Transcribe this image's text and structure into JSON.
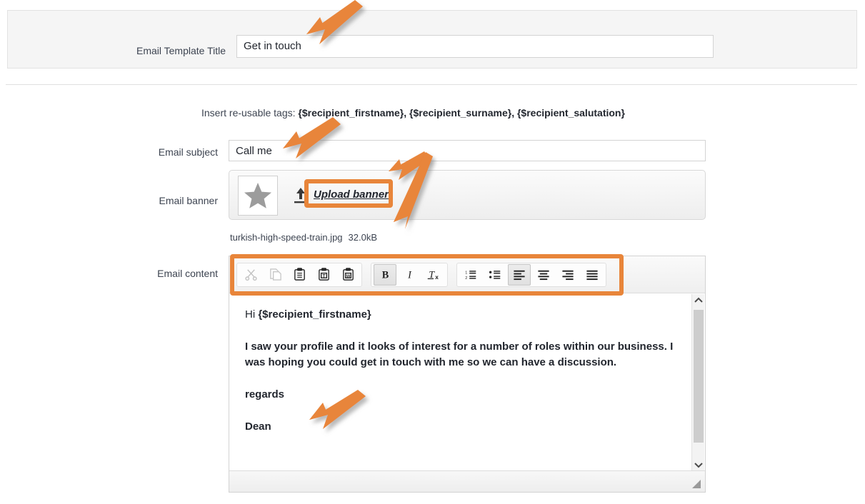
{
  "form": {
    "title_label": "Email Template Title",
    "title_value": "Get in touch",
    "tags_prefix": "Insert re-usable tags: ",
    "tags_list": "{$recipient_firstname}, {$recipient_surname}, {$recipient_salutation}",
    "subject_label": "Email subject",
    "subject_value": "Call me",
    "banner_label": "Email banner",
    "upload_text": "Upload banner",
    "filename": "turkish-high-speed-train.jpg",
    "filesize": "32.0kB",
    "content_label": "Email content"
  },
  "toolbar": {
    "buttons": [
      {
        "name": "cut",
        "label": "Cut",
        "state": "disabled"
      },
      {
        "name": "copy",
        "label": "Copy",
        "state": "disabled"
      },
      {
        "name": "paste",
        "label": "Paste",
        "state": "enabled"
      },
      {
        "name": "paste-text",
        "label": "Paste as plain text",
        "state": "enabled"
      },
      {
        "name": "paste-word",
        "label": "Paste from Word",
        "state": "enabled"
      },
      {
        "name": "bold",
        "label": "Bold",
        "state": "active"
      },
      {
        "name": "italic",
        "label": "Italic",
        "state": "enabled"
      },
      {
        "name": "remove-format",
        "label": "Remove Format",
        "state": "enabled"
      },
      {
        "name": "numbered-list",
        "label": "Insert/Remove Numbered List",
        "state": "enabled"
      },
      {
        "name": "bulleted-list",
        "label": "Insert/Remove Bulleted List",
        "state": "enabled"
      },
      {
        "name": "align-left",
        "label": "Align Left",
        "state": "active"
      },
      {
        "name": "align-center",
        "label": "Center",
        "state": "enabled"
      },
      {
        "name": "align-right",
        "label": "Align Right",
        "state": "enabled"
      },
      {
        "name": "justify",
        "label": "Justify",
        "state": "enabled"
      }
    ]
  },
  "content": {
    "greeting_prefix": "Hi ",
    "greeting_tag": "{$recipient_firstname}",
    "paragraph": "I saw your profile and it looks of interest for a number of roles within our business. I was hoping you could get in touch with me so we can have a discussion.",
    "signoff": "regards",
    "signature": "Dean"
  },
  "annotations": {
    "color": "#e8853a",
    "arrow_count": 5,
    "highlight_boxes": 2
  }
}
